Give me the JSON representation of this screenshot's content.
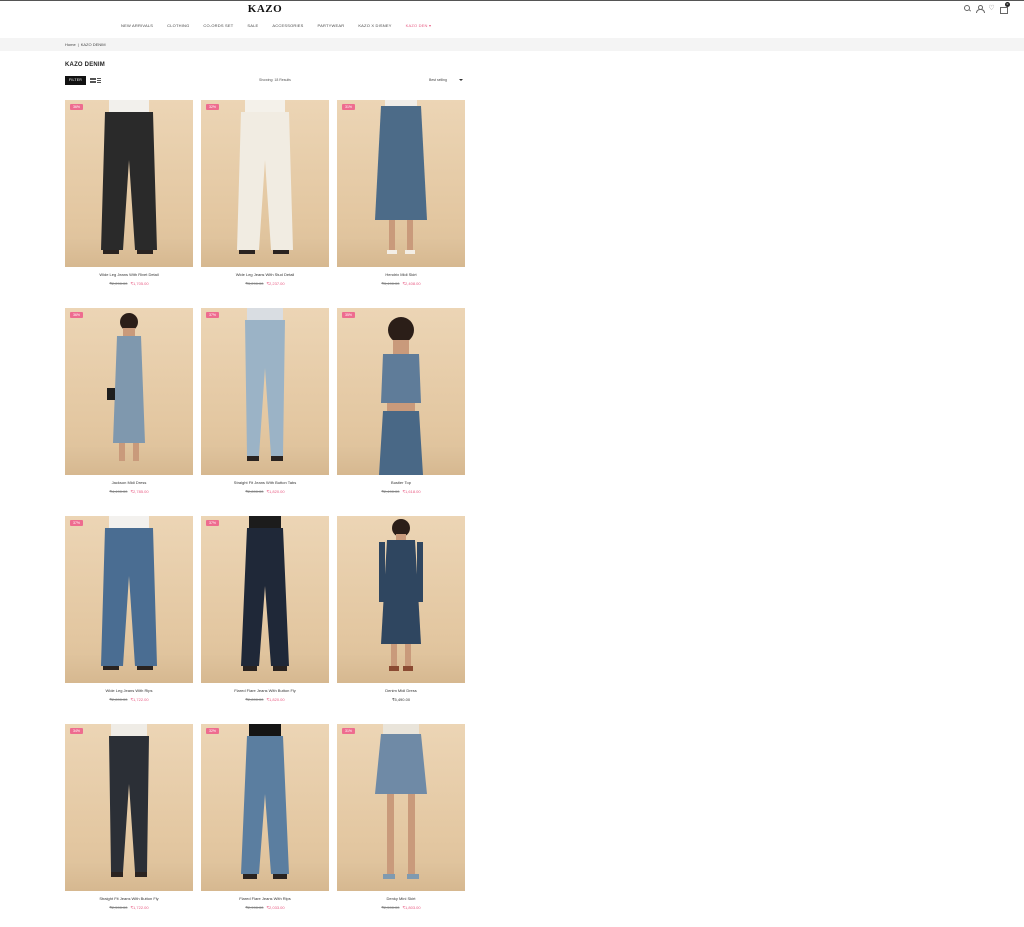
{
  "brand": {
    "logo": "KAZO"
  },
  "nav": [
    {
      "label": "NEW ARRIVALS"
    },
    {
      "label": "CLOTHING"
    },
    {
      "label": "CO-ORDS SET"
    },
    {
      "label": "SALE"
    },
    {
      "label": "ACCESSORIES"
    },
    {
      "label": "PARTYWEAR"
    },
    {
      "label": "KAZO X DISNEY"
    },
    {
      "label": "KAZO DEN ▾",
      "active": true
    }
  ],
  "header_icons": [
    "search-icon",
    "user-icon",
    "heart-icon",
    "bag-icon"
  ],
  "cart_count": "0",
  "breadcrumb": {
    "home": "Home",
    "separator": "|",
    "current": "KAZO DENIM"
  },
  "page_title": "KAZO DENIM",
  "toolbar": {
    "filter_label": "FILTER",
    "results_text": "Showing: 18 Results",
    "sort_label": "Best selling"
  },
  "colors": {
    "accent": "#e85a82",
    "badge": "#ee6c8f",
    "image_bg": "#e6ccaa"
  },
  "products": [
    {
      "badge": "36%",
      "name": "Wide Leg Jeans With Rivet Detail",
      "old_price": "₹2,290.00",
      "price": "₹1,705.00",
      "garment": "black-jeans"
    },
    {
      "badge": "32%",
      "name": "Wide Leg Jeans With Stud Detail",
      "old_price": "₹3,290.00",
      "price": "₹2,237.00",
      "garment": "white-jeans"
    },
    {
      "badge": "31%",
      "name": "Hendrix Midi Skirt",
      "old_price": "₹3,490.00",
      "price": "₹2,408.00",
      "garment": "denim-skirt"
    },
    {
      "badge": "36%",
      "name": "Jackson Midi Dress",
      "old_price": "₹4,490.00",
      "price": "₹2,785.00",
      "garment": "denim-dress"
    },
    {
      "badge": "37%",
      "name": "Straight Fit Jeans With Button Tabs",
      "old_price": "₹2,890.00",
      "price": "₹1,820.00",
      "garment": "light-jeans"
    },
    {
      "badge": "35%",
      "name": "Bustier Top",
      "old_price": "₹2,490.00",
      "price": "₹1,618.00",
      "garment": "bustier-top"
    },
    {
      "badge": "37%",
      "name": "Wide Leg Jeans With Rips",
      "old_price": "₹2,890.00",
      "price": "₹1,722.00",
      "garment": "ripped-jeans"
    },
    {
      "badge": "37%",
      "name": "Flared Flare Jeans With Button Fly",
      "old_price": "₹2,890.00",
      "price": "₹1,820.00",
      "garment": "dark-flare"
    },
    {
      "badge": "",
      "name": "Denim Midi Dress",
      "old_price": "",
      "price": "₹5,490.00",
      "garment": "shirt-dress"
    },
    {
      "badge": "34%",
      "name": "Straight Fit Jeans With Button Fly",
      "old_price": "₹2,590.00",
      "price": "₹1,722.00",
      "garment": "black-straight"
    },
    {
      "badge": "32%",
      "name": "Flared Flare Jeans With Rips",
      "old_price": "₹2,990.00",
      "price": "₹2,033.00",
      "garment": "ripped-flare"
    },
    {
      "badge": "31%",
      "name": "Denky Mini Skirt",
      "old_price": "₹2,590.00",
      "price": "₹1,803.00",
      "garment": "mini-skirt"
    }
  ]
}
